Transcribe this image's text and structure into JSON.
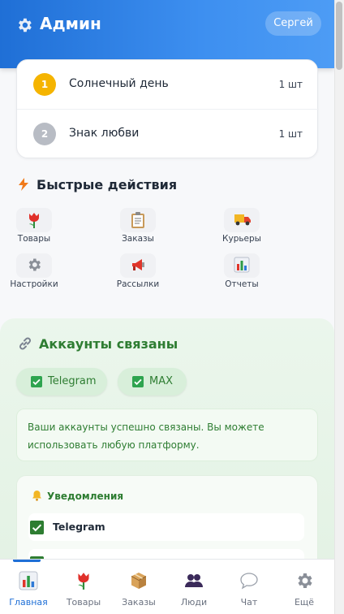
{
  "header": {
    "title": "Админ",
    "user_name": "Сергей"
  },
  "ranking": [
    {
      "rank": "1",
      "name": "Солнечный день",
      "qty": "1 шт"
    },
    {
      "rank": "2",
      "name": "Знак любви",
      "qty": "1 шт"
    }
  ],
  "quick_actions": {
    "title": "Быстрые действия",
    "items": [
      {
        "label": "Товары",
        "icon": "tulip-icon"
      },
      {
        "label": "Заказы",
        "icon": "clipboard-icon"
      },
      {
        "label": "Курьеры",
        "icon": "truck-icon"
      },
      {
        "label": "Настройки",
        "icon": "gear-icon"
      },
      {
        "label": "Рассылки",
        "icon": "megaphone-icon"
      },
      {
        "label": "Отчеты",
        "icon": "bar-chart-icon"
      }
    ]
  },
  "linked": {
    "title": "Аккаунты связаны",
    "chips": [
      "Telegram",
      "MAX"
    ],
    "info": "Ваши аккаунты успешно связаны. Вы можете использовать любую платформу.",
    "notifications": {
      "title": "Уведомления",
      "items": [
        "Telegram",
        ""
      ]
    }
  },
  "bottom_nav": {
    "items": [
      {
        "label": "Главная",
        "icon": "bar-chart-icon",
        "active": true
      },
      {
        "label": "Товары",
        "icon": "tulip-icon",
        "active": false
      },
      {
        "label": "Заказы",
        "icon": "package-icon",
        "active": false
      },
      {
        "label": "Люди",
        "icon": "people-icon",
        "active": false
      },
      {
        "label": "Чат",
        "icon": "speech-bubble-icon",
        "active": false
      },
      {
        "label": "Ещё",
        "icon": "gear-icon",
        "active": false
      }
    ]
  },
  "colors": {
    "header": "#1f6fd6",
    "accent_green": "#2e7d32",
    "gold": "#f5b400",
    "silver": "#b8bcc4"
  }
}
